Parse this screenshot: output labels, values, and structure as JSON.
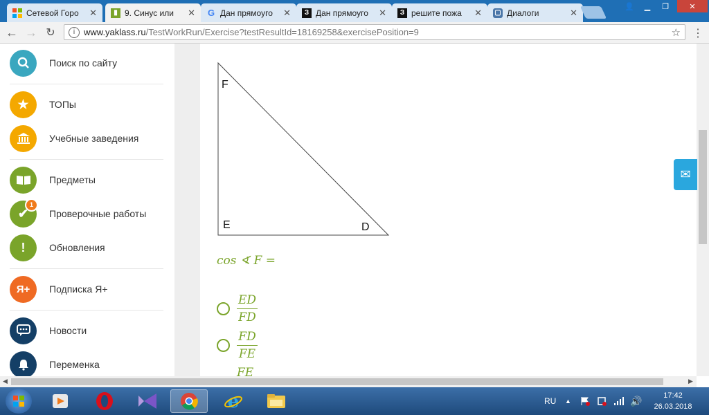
{
  "tabs": [
    {
      "title": "Сетевой Горо",
      "active": false
    },
    {
      "title": "9. Синус или",
      "active": true
    },
    {
      "title": "Дан прямоуго",
      "active": false
    },
    {
      "title": "Дан прямоуго",
      "active": false
    },
    {
      "title": "решите пожа",
      "active": false
    },
    {
      "title": "Диалоги",
      "active": false
    }
  ],
  "address": {
    "host": "www.yaklass.ru",
    "path": "/TestWorkRun/Exercise?testResultId=18169258&exercisePosition=9"
  },
  "sidebar": {
    "items": [
      {
        "label": "Поиск по сайту",
        "icon": "search-icon",
        "color": "#3aa7bf"
      },
      {
        "label": "ТОПы",
        "icon": "star-icon",
        "color": "#f4a800"
      },
      {
        "label": "Учебные заведения",
        "icon": "building-icon",
        "color": "#f4a800"
      },
      {
        "label": "Предметы",
        "icon": "book-icon",
        "color": "#7aa42a"
      },
      {
        "label": "Проверочные работы",
        "icon": "check-icon",
        "color": "#7aa42a",
        "badge": "1"
      },
      {
        "label": "Обновления",
        "icon": "exclamation-icon",
        "color": "#7aa42a"
      },
      {
        "label": "Подписка Я+",
        "icon": "ya-plus-icon",
        "color": "#ef6a23",
        "icon_text": "Я+"
      },
      {
        "label": "Новости",
        "icon": "chat-icon",
        "color": "#143f66"
      },
      {
        "label": "Переменка",
        "icon": "bell-icon",
        "color": "#143f66"
      }
    ]
  },
  "exercise": {
    "vertices": {
      "f": "F",
      "e": "E",
      "d": "D"
    },
    "question": "cos ∢ F =",
    "options": [
      {
        "num": "ED",
        "den": "FD"
      },
      {
        "num": "FD",
        "den": "FE"
      },
      {
        "num": "FE",
        "den": ""
      }
    ]
  },
  "taskbar": {
    "lang": "RU",
    "time": "17:42",
    "date": "26.03.2018"
  }
}
